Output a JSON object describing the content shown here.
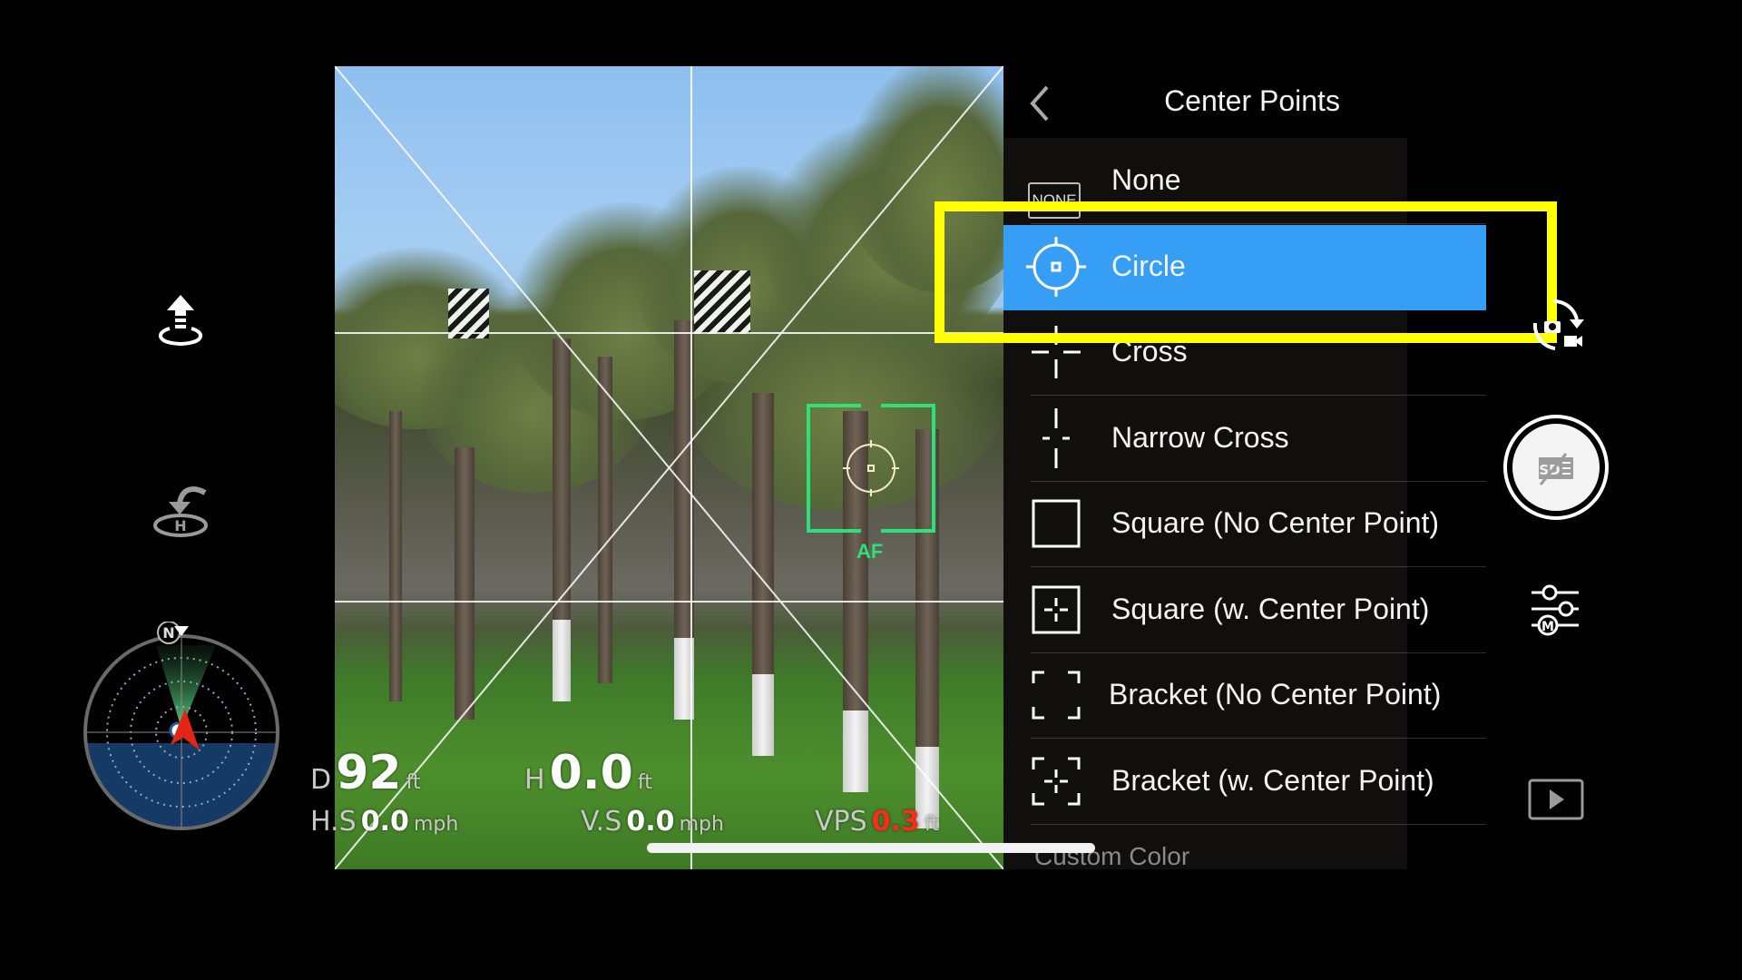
{
  "panel": {
    "title": "Center Points",
    "back_icon": "chevron-left-icon",
    "options": [
      {
        "label": "None",
        "icon": "none-badge-icon",
        "badge_text": "NONE",
        "selected": false
      },
      {
        "label": "Circle",
        "icon": "circle-reticle-icon",
        "selected": true
      },
      {
        "label": "Cross",
        "icon": "cross-reticle-icon",
        "selected": false
      },
      {
        "label": "Narrow Cross",
        "icon": "narrow-cross-reticle-icon",
        "selected": false
      },
      {
        "label": "Square (No Center Point)",
        "icon": "square-reticle-icon",
        "selected": false
      },
      {
        "label": "Square (w. Center Point)",
        "icon": "square-center-reticle-icon",
        "selected": false
      },
      {
        "label": "Bracket (No Center Point)",
        "icon": "bracket-reticle-icon",
        "selected": false
      },
      {
        "label": "Bracket (w. Center Point)",
        "icon": "bracket-center-reticle-icon",
        "selected": false
      }
    ],
    "next_section_label": "Custom Color",
    "selected_color": "#379ef5",
    "highlight_color": "#ffff00"
  },
  "camera": {
    "af_label": "AF",
    "af_color": "#2ee07a"
  },
  "telemetry": {
    "distance": {
      "label": "D",
      "value": "92",
      "unit": "ft"
    },
    "height": {
      "label": "H",
      "value": "0.0",
      "unit": "ft"
    },
    "horizontal_speed": {
      "label": "H.S",
      "value": "0.0",
      "unit": "mph"
    },
    "vertical_speed": {
      "label": "V.S",
      "value": "0.0",
      "unit": "mph"
    },
    "vps": {
      "label": "VPS",
      "value": "0.3",
      "unit": "ft",
      "value_color": "#ff2a1a"
    }
  },
  "left_controls": {
    "takeoff_icon": "takeoff-icon",
    "return_home_icon": "return-to-home-icon",
    "radar": {
      "north_label": "N"
    }
  },
  "right_controls": {
    "mode_switch_icon": "photo-video-switch-icon",
    "shutter_icon": "no-sd-card-icon",
    "settings_icon": "camera-settings-icon",
    "playback_icon": "playback-icon"
  }
}
